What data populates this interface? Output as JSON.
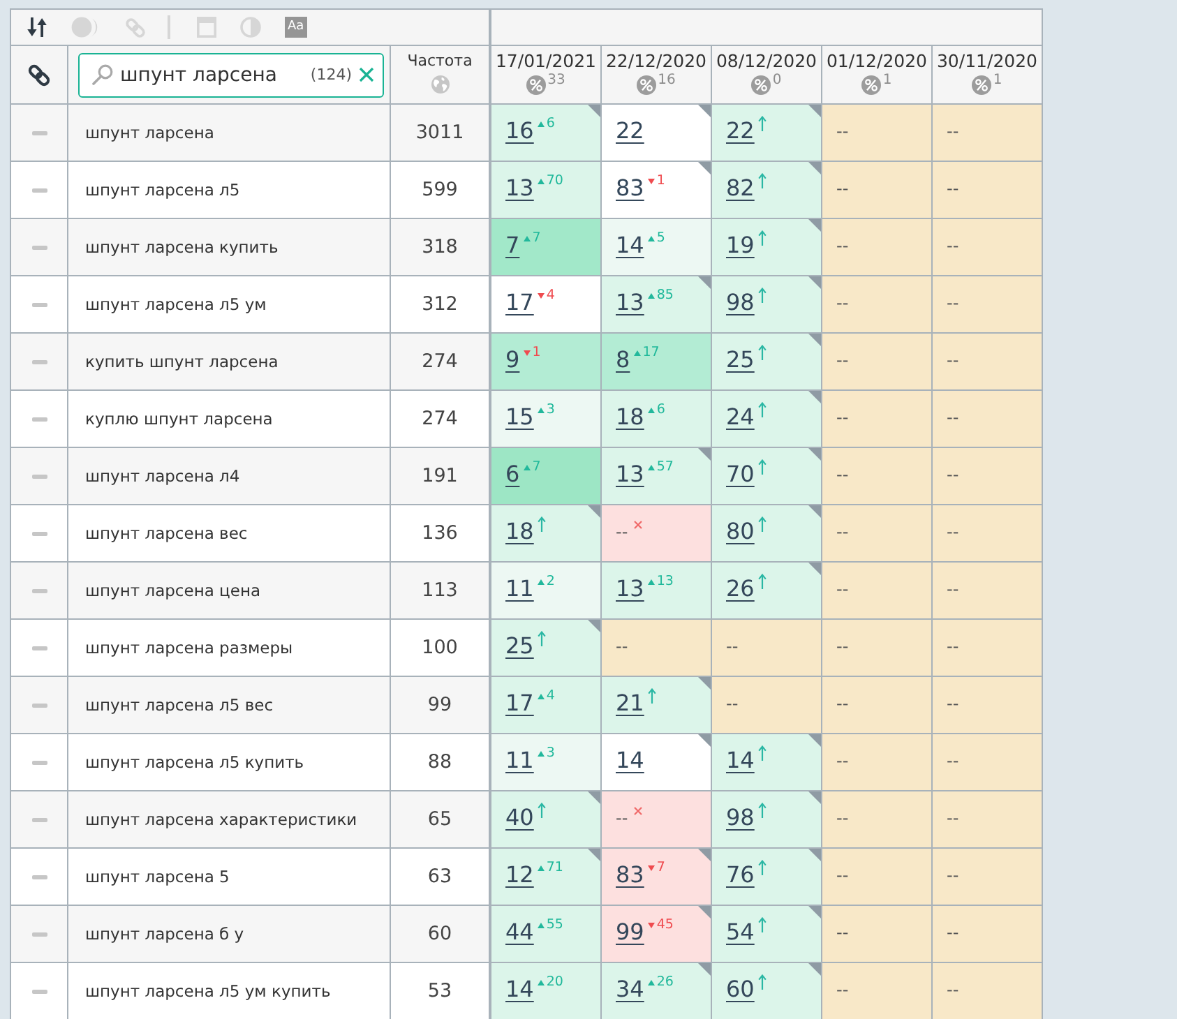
{
  "toolbar_groups": [
    {
      "items": [
        {
          "kind": "sort",
          "disabled": false
        },
        {
          "kind": "toggle",
          "disabled": true
        },
        {
          "kind": "link",
          "disabled": true
        }
      ]
    },
    {
      "items": [
        {
          "kind": "window",
          "disabled": true
        },
        {
          "kind": "contrast",
          "disabled": true
        },
        {
          "kind": "font",
          "label": "Aa",
          "disabled": true
        }
      ]
    }
  ],
  "search": {
    "value": "шпунт ларсена",
    "count": "(124)"
  },
  "frequency_header": "Частота",
  "dates": [
    {
      "label": "17/01/2021",
      "count": "33"
    },
    {
      "label": "22/12/2020",
      "count": "16"
    },
    {
      "label": "08/12/2020",
      "count": "0"
    },
    {
      "label": "01/12/2020",
      "count": "1"
    },
    {
      "label": "30/11/2020",
      "count": "1"
    }
  ],
  "rows": [
    {
      "keyword": "шпунт ларсена",
      "frequency": "3011",
      "positions": [
        {
          "kind": "up",
          "value": "16",
          "change": "6",
          "color": "#dcf5ea",
          "flagged": true
        },
        {
          "kind": "plain",
          "value": "22",
          "color": "#ffffff",
          "flagged": true
        },
        {
          "kind": "new",
          "value": "22",
          "color": "#dcf5ea",
          "flagged": true
        },
        {
          "kind": "empty",
          "value": "--",
          "color": "#f8e8c8",
          "flagged": false
        },
        {
          "kind": "empty",
          "value": "--",
          "color": "#f8e8c8",
          "flagged": false
        }
      ]
    },
    {
      "keyword": "шпунт ларсена л5",
      "frequency": "599",
      "positions": [
        {
          "kind": "up",
          "value": "13",
          "change": "70",
          "color": "#dcf5ea",
          "flagged": false
        },
        {
          "kind": "down",
          "value": "83",
          "change": "1",
          "color": "#ffffff",
          "flagged": true
        },
        {
          "kind": "new",
          "value": "82",
          "color": "#dcf5ea",
          "flagged": true
        },
        {
          "kind": "empty",
          "value": "--",
          "color": "#f8e8c8",
          "flagged": false
        },
        {
          "kind": "empty",
          "value": "--",
          "color": "#f8e8c8",
          "flagged": false
        }
      ]
    },
    {
      "keyword": "шпунт ларсена купить",
      "frequency": "318",
      "positions": [
        {
          "kind": "up",
          "value": "7",
          "change": "7",
          "color": "#a2e8c9",
          "flagged": false
        },
        {
          "kind": "up",
          "value": "14",
          "change": "5",
          "color": "#edf8f3",
          "flagged": false
        },
        {
          "kind": "new",
          "value": "19",
          "color": "#dcf5ea",
          "flagged": true
        },
        {
          "kind": "empty",
          "value": "--",
          "color": "#f8e8c8",
          "flagged": false
        },
        {
          "kind": "empty",
          "value": "--",
          "color": "#f8e8c8",
          "flagged": false
        }
      ]
    },
    {
      "keyword": "шпунт ларсена л5 ум",
      "frequency": "312",
      "positions": [
        {
          "kind": "down",
          "value": "17",
          "change": "4",
          "color": "#ffffff",
          "flagged": false
        },
        {
          "kind": "up",
          "value": "13",
          "change": "85",
          "color": "#dcf5ea",
          "flagged": true
        },
        {
          "kind": "new",
          "value": "98",
          "color": "#dcf5ea",
          "flagged": true
        },
        {
          "kind": "empty",
          "value": "--",
          "color": "#f8e8c8",
          "flagged": false
        },
        {
          "kind": "empty",
          "value": "--",
          "color": "#f8e8c8",
          "flagged": false
        }
      ]
    },
    {
      "keyword": "купить шпунт ларсена",
      "frequency": "274",
      "positions": [
        {
          "kind": "down",
          "value": "9",
          "change": "1",
          "color": "#b3ecd4",
          "flagged": false
        },
        {
          "kind": "up",
          "value": "8",
          "change": "17",
          "color": "#b3ecd4",
          "flagged": false
        },
        {
          "kind": "new",
          "value": "25",
          "color": "#dcf5ea",
          "flagged": true
        },
        {
          "kind": "empty",
          "value": "--",
          "color": "#f8e8c8",
          "flagged": false
        },
        {
          "kind": "empty",
          "value": "--",
          "color": "#f8e8c8",
          "flagged": false
        }
      ]
    },
    {
      "keyword": "куплю шпунт ларсена",
      "frequency": "274",
      "positions": [
        {
          "kind": "up",
          "value": "15",
          "change": "3",
          "color": "#edf8f3",
          "flagged": false
        },
        {
          "kind": "up",
          "value": "18",
          "change": "6",
          "color": "#dcf5ea",
          "flagged": false
        },
        {
          "kind": "new",
          "value": "24",
          "color": "#dcf5ea",
          "flagged": true
        },
        {
          "kind": "empty",
          "value": "--",
          "color": "#f8e8c8",
          "flagged": false
        },
        {
          "kind": "empty",
          "value": "--",
          "color": "#f8e8c8",
          "flagged": false
        }
      ]
    },
    {
      "keyword": "шпунт ларсена л4",
      "frequency": "191",
      "positions": [
        {
          "kind": "up",
          "value": "6",
          "change": "7",
          "color": "#9de6c5",
          "flagged": false
        },
        {
          "kind": "up",
          "value": "13",
          "change": "57",
          "color": "#dcf5ea",
          "flagged": true
        },
        {
          "kind": "new",
          "value": "70",
          "color": "#dcf5ea",
          "flagged": true
        },
        {
          "kind": "empty",
          "value": "--",
          "color": "#f8e8c8",
          "flagged": false
        },
        {
          "kind": "empty",
          "value": "--",
          "color": "#f8e8c8",
          "flagged": false
        }
      ]
    },
    {
      "keyword": "шпунт ларсена вес",
      "frequency": "136",
      "positions": [
        {
          "kind": "new",
          "value": "18",
          "color": "#dcf5ea",
          "flagged": true
        },
        {
          "kind": "lost",
          "value": "--",
          "color": "#fde0df",
          "flagged": false
        },
        {
          "kind": "new",
          "value": "80",
          "color": "#dcf5ea",
          "flagged": true
        },
        {
          "kind": "empty",
          "value": "--",
          "color": "#f8e8c8",
          "flagged": false
        },
        {
          "kind": "empty",
          "value": "--",
          "color": "#f8e8c8",
          "flagged": false
        }
      ]
    },
    {
      "keyword": "шпунт ларсена цена",
      "frequency": "113",
      "positions": [
        {
          "kind": "up",
          "value": "11",
          "change": "2",
          "color": "#edf8f3",
          "flagged": false
        },
        {
          "kind": "up",
          "value": "13",
          "change": "13",
          "color": "#dcf5ea",
          "flagged": false
        },
        {
          "kind": "new",
          "value": "26",
          "color": "#dcf5ea",
          "flagged": true
        },
        {
          "kind": "empty",
          "value": "--",
          "color": "#f8e8c8",
          "flagged": false
        },
        {
          "kind": "empty",
          "value": "--",
          "color": "#f8e8c8",
          "flagged": false
        }
      ]
    },
    {
      "keyword": "шпунт ларсена размеры",
      "frequency": "100",
      "positions": [
        {
          "kind": "new",
          "value": "25",
          "color": "#dcf5ea",
          "flagged": true
        },
        {
          "kind": "empty",
          "value": "--",
          "color": "#f8e8c8",
          "flagged": false
        },
        {
          "kind": "empty",
          "value": "--",
          "color": "#f8e8c8",
          "flagged": false
        },
        {
          "kind": "empty",
          "value": "--",
          "color": "#f8e8c8",
          "flagged": false
        },
        {
          "kind": "empty",
          "value": "--",
          "color": "#f8e8c8",
          "flagged": false
        }
      ]
    },
    {
      "keyword": "шпунт ларсена л5 вес",
      "frequency": "99",
      "positions": [
        {
          "kind": "up",
          "value": "17",
          "change": "4",
          "color": "#dcf5ea",
          "flagged": false
        },
        {
          "kind": "new",
          "value": "21",
          "color": "#dcf5ea",
          "flagged": true
        },
        {
          "kind": "empty",
          "value": "--",
          "color": "#f8e8c8",
          "flagged": false
        },
        {
          "kind": "empty",
          "value": "--",
          "color": "#f8e8c8",
          "flagged": false
        },
        {
          "kind": "empty",
          "value": "--",
          "color": "#f8e8c8",
          "flagged": false
        }
      ]
    },
    {
      "keyword": "шпунт ларсена л5 купить",
      "frequency": "88",
      "positions": [
        {
          "kind": "up",
          "value": "11",
          "change": "3",
          "color": "#edf8f3",
          "flagged": false
        },
        {
          "kind": "plain",
          "value": "14",
          "color": "#ffffff",
          "flagged": true
        },
        {
          "kind": "new",
          "value": "14",
          "color": "#dcf5ea",
          "flagged": true
        },
        {
          "kind": "empty",
          "value": "--",
          "color": "#f8e8c8",
          "flagged": false
        },
        {
          "kind": "empty",
          "value": "--",
          "color": "#f8e8c8",
          "flagged": false
        }
      ]
    },
    {
      "keyword": "шпунт ларсена характеристики",
      "frequency": "65",
      "positions": [
        {
          "kind": "new",
          "value": "40",
          "color": "#dcf5ea",
          "flagged": true
        },
        {
          "kind": "lost",
          "value": "--",
          "color": "#fde0df",
          "flagged": false
        },
        {
          "kind": "new",
          "value": "98",
          "color": "#dcf5ea",
          "flagged": true
        },
        {
          "kind": "empty",
          "value": "--",
          "color": "#f8e8c8",
          "flagged": false
        },
        {
          "kind": "empty",
          "value": "--",
          "color": "#f8e8c8",
          "flagged": false
        }
      ]
    },
    {
      "keyword": "шпунт ларсена 5",
      "frequency": "63",
      "positions": [
        {
          "kind": "up",
          "value": "12",
          "change": "71",
          "color": "#dcf5ea",
          "flagged": true
        },
        {
          "kind": "down",
          "value": "83",
          "change": "7",
          "color": "#fde0df",
          "flagged": true
        },
        {
          "kind": "new",
          "value": "76",
          "color": "#dcf5ea",
          "flagged": true
        },
        {
          "kind": "empty",
          "value": "--",
          "color": "#f8e8c8",
          "flagged": false
        },
        {
          "kind": "empty",
          "value": "--",
          "color": "#f8e8c8",
          "flagged": false
        }
      ]
    },
    {
      "keyword": "шпунт ларсена б у",
      "frequency": "60",
      "positions": [
        {
          "kind": "up",
          "value": "44",
          "change": "55",
          "color": "#dcf5ea",
          "flagged": false
        },
        {
          "kind": "down",
          "value": "99",
          "change": "45",
          "color": "#fde0df",
          "flagged": true
        },
        {
          "kind": "new",
          "value": "54",
          "color": "#dcf5ea",
          "flagged": true
        },
        {
          "kind": "empty",
          "value": "--",
          "color": "#f8e8c8",
          "flagged": false
        },
        {
          "kind": "empty",
          "value": "--",
          "color": "#f8e8c8",
          "flagged": false
        }
      ]
    },
    {
      "keyword": "шпунт ларсена л5 ум купить",
      "frequency": "53",
      "positions": [
        {
          "kind": "up",
          "value": "14",
          "change": "20",
          "color": "#dcf5ea",
          "flagged": false
        },
        {
          "kind": "up",
          "value": "34",
          "change": "26",
          "color": "#dcf5ea",
          "flagged": true
        },
        {
          "kind": "new",
          "value": "60",
          "color": "#dcf5ea",
          "flagged": true
        },
        {
          "kind": "empty",
          "value": "--",
          "color": "#f8e8c8",
          "flagged": false
        },
        {
          "kind": "empty",
          "value": "--",
          "color": "#f8e8c8",
          "flagged": false
        }
      ]
    }
  ]
}
